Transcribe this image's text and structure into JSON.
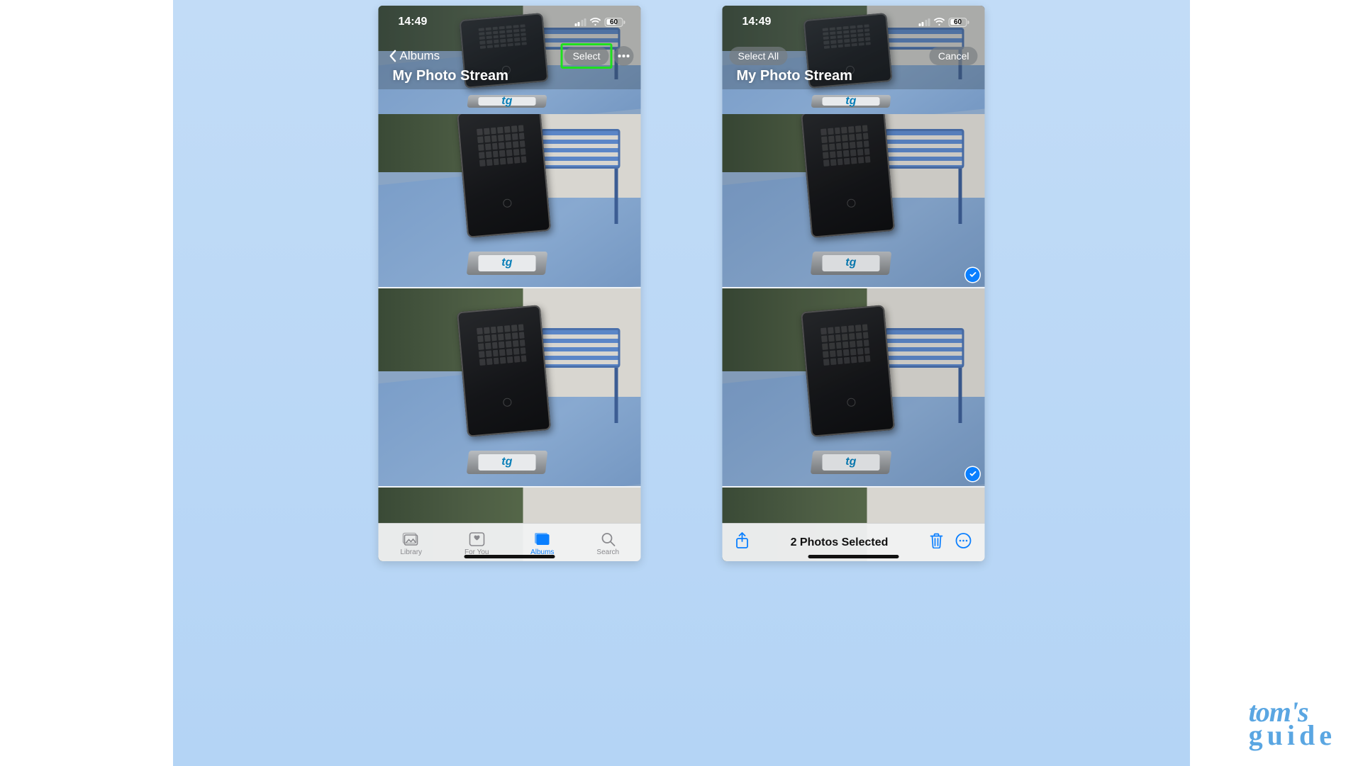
{
  "status": {
    "time": "14:49",
    "battery_pct": "60",
    "battery_fill_pct": 60,
    "signal_bars_active": 2
  },
  "left_screen": {
    "back_label": "Albums",
    "title": "My Photo Stream",
    "select_label": "Select"
  },
  "right_screen": {
    "title": "My Photo Stream",
    "select_all_label": "Select All",
    "cancel_label": "Cancel",
    "selected_text": "2 Photos Selected"
  },
  "tabs": {
    "library": "Library",
    "for_you": "For You",
    "albums": "Albums",
    "search": "Search"
  },
  "stand_logo": "tg",
  "watermark": {
    "line1": "tom's",
    "line2": "guide"
  },
  "colors": {
    "accent": "#0a7fff",
    "highlight": "#1ee01e"
  }
}
